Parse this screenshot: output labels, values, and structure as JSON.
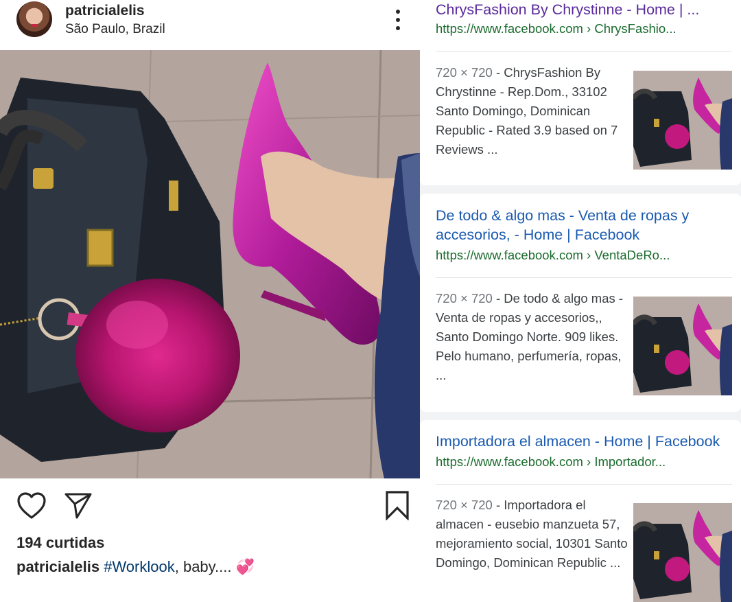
{
  "instagram": {
    "username": "patricialelis",
    "location": "São Paulo, Brazil",
    "likes": "194 curtidas",
    "caption": {
      "user": "patricialelis",
      "hashtag": "#Worklook",
      "text": ", baby....",
      "emoji": "💞"
    },
    "icons": [
      "avatar",
      "more-icon",
      "heart-icon",
      "share-icon",
      "bookmark-icon"
    ]
  },
  "search": {
    "results": [
      {
        "title": "ChrysFashion By Chrystinne - Home | ...",
        "url": "https://www.facebook.com › ChrysFashio...",
        "size": "720 × 720",
        "description": " - ChrysFashion By Chrystinne - Rep.Dom., 33102 Santo Domingo, Dominican Republic - Rated 3.9 based on 7 Reviews ..."
      },
      {
        "title": "De todo & algo mas - Venta de ropas y accesorios, - Home | Facebook",
        "url": "https://www.facebook.com › VentaDeRo...",
        "size": "720 × 720",
        "description": " - De todo & algo mas - Venta de ropas y accesorios,, Santo Domingo Norte. 909 likes. Pelo humano, perfumería, ropas, ..."
      },
      {
        "title": "Importadora el almacen - Home | Facebook",
        "url": "https://www.facebook.com › Importador...",
        "size": "720 × 720",
        "description": " - Importadora el almacen - eusebio manzueta 57, mejoramiento social, 10301 Santo Domingo, Dominican Republic ..."
      }
    ]
  },
  "colors": {
    "link_title": "#1a0dab",
    "url_green": "#1a6b2d",
    "text": "#262626",
    "hashtag": "#00376b",
    "accent_magenta": "#c2197f"
  }
}
